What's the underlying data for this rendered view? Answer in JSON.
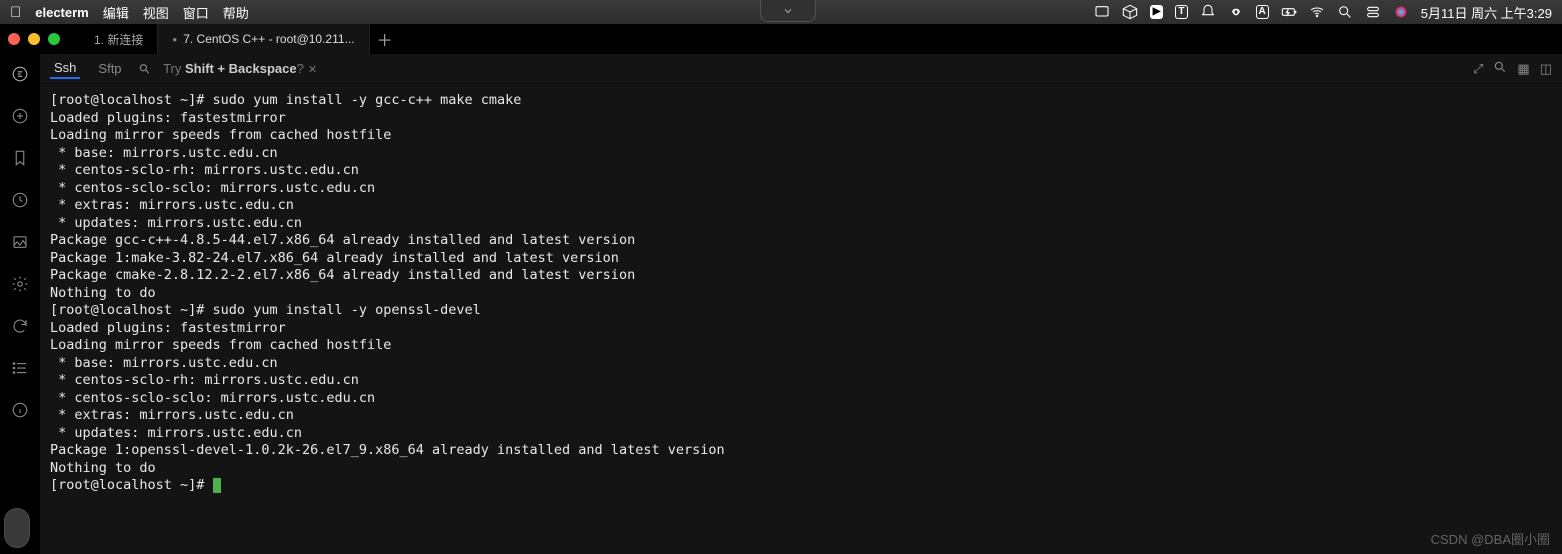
{
  "menubar": {
    "app_name": "electerm",
    "menus": [
      "编辑",
      "视图",
      "窗口",
      "帮助"
    ],
    "clock": "5月11日 周六 上午3:29"
  },
  "tabs": {
    "items": [
      {
        "label": "1. 新连接"
      },
      {
        "label": "7. CentOS C++ - root@10.211..."
      }
    ],
    "active_index": 1
  },
  "subbar": {
    "ssh": "Ssh",
    "sftp": "Sftp",
    "hint_prefix": "Try ",
    "hint_shortcut": "Shift + Backspace",
    "hint_q": "?"
  },
  "terminal": {
    "lines": [
      "[root@localhost ~]# sudo yum install -y gcc-c++ make cmake",
      "Loaded plugins: fastestmirror",
      "Loading mirror speeds from cached hostfile",
      " * base: mirrors.ustc.edu.cn",
      " * centos-sclo-rh: mirrors.ustc.edu.cn",
      " * centos-sclo-sclo: mirrors.ustc.edu.cn",
      " * extras: mirrors.ustc.edu.cn",
      " * updates: mirrors.ustc.edu.cn",
      "Package gcc-c++-4.8.5-44.el7.x86_64 already installed and latest version",
      "Package 1:make-3.82-24.el7.x86_64 already installed and latest version",
      "Package cmake-2.8.12.2-2.el7.x86_64 already installed and latest version",
      "Nothing to do",
      "[root@localhost ~]# sudo yum install -y openssl-devel",
      "Loaded plugins: fastestmirror",
      "Loading mirror speeds from cached hostfile",
      " * base: mirrors.ustc.edu.cn",
      " * centos-sclo-rh: mirrors.ustc.edu.cn",
      " * centos-sclo-sclo: mirrors.ustc.edu.cn",
      " * extras: mirrors.ustc.edu.cn",
      " * updates: mirrors.ustc.edu.cn",
      "Package 1:openssl-devel-1.0.2k-26.el7_9.x86_64 already installed and latest version",
      "Nothing to do",
      "[root@localhost ~]# "
    ]
  },
  "watermark": "CSDN @DBA圈小圈",
  "icons": {
    "menubar_right": [
      "cast-icon",
      "cube-icon",
      "play-icon",
      "text-box-icon",
      "bell-icon",
      "infinity-icon",
      "input-a-icon",
      "battery-charging-icon",
      "wifi-icon",
      "search-icon",
      "control-center-icon",
      "siri-icon"
    ]
  }
}
